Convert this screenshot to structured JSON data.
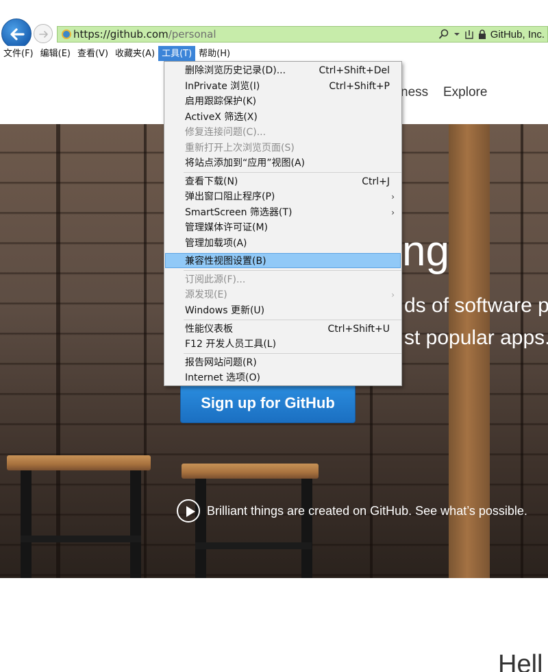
{
  "address": {
    "url_prefix": "https://github.com",
    "url_rest": "/personal",
    "site_identity": "GitHub, Inc."
  },
  "menubar": {
    "items": [
      {
        "label": "文件(F)"
      },
      {
        "label": "编辑(E)"
      },
      {
        "label": "查看(V)"
      },
      {
        "label": "收藏夹(A)"
      },
      {
        "label": "工具(T)"
      },
      {
        "label": "帮助(H)"
      }
    ],
    "active_index": 4
  },
  "page": {
    "nav": {
      "business": "ness",
      "explore": "Explore"
    },
    "hero_big": "ng",
    "hero_line1": "ds of software p",
    "hero_line2": "st popular apps.",
    "signup": "Sign up for GitHub",
    "video_text": "Brilliant things are created on GitHub. See what’s possible.",
    "hello": "Hell"
  },
  "tools_menu": {
    "items": [
      {
        "label": "删除浏览历史记录(D)...",
        "shortcut": "Ctrl+Shift+Del"
      },
      {
        "label": "InPrivate 浏览(I)",
        "shortcut": "Ctrl+Shift+P"
      },
      {
        "label": "启用跟踪保护(K)",
        "shortcut": ""
      },
      {
        "label": "ActiveX 筛选(X)",
        "shortcut": ""
      },
      {
        "label": "修复连接问题(C)...",
        "shortcut": ""
      },
      {
        "label": "重新打开上次浏览页面(S)",
        "shortcut": ""
      },
      {
        "label": "将站点添加到“应用”视图(A)",
        "shortcut": ""
      },
      {
        "label": "查看下载(N)",
        "shortcut": "Ctrl+J"
      },
      {
        "label": "弹出窗口阻止程序(P)",
        "shortcut": ""
      },
      {
        "label": "SmartScreen 筛选器(T)",
        "shortcut": ""
      },
      {
        "label": "管理媒体许可证(M)",
        "shortcut": ""
      },
      {
        "label": "管理加载项(A)",
        "shortcut": ""
      },
      {
        "label": "兼容性视图设置(B)",
        "shortcut": ""
      },
      {
        "label": "订阅此源(F)...",
        "shortcut": ""
      },
      {
        "label": "源发现(E)",
        "shortcut": ""
      },
      {
        "label": "Windows 更新(U)",
        "shortcut": ""
      },
      {
        "label": "性能仪表板",
        "shortcut": "Ctrl+Shift+U"
      },
      {
        "label": "F12 开发人员工具(L)",
        "shortcut": ""
      },
      {
        "label": "报告网站问题(R)",
        "shortcut": ""
      },
      {
        "label": "Internet 选项(O)",
        "shortcut": ""
      }
    ]
  },
  "colors": {
    "menu_highlight": "#91c9f7",
    "address_bar_green": "#c7ecaa",
    "active_menu": "#3b84d8",
    "signup_button": "#1f7bd0"
  }
}
